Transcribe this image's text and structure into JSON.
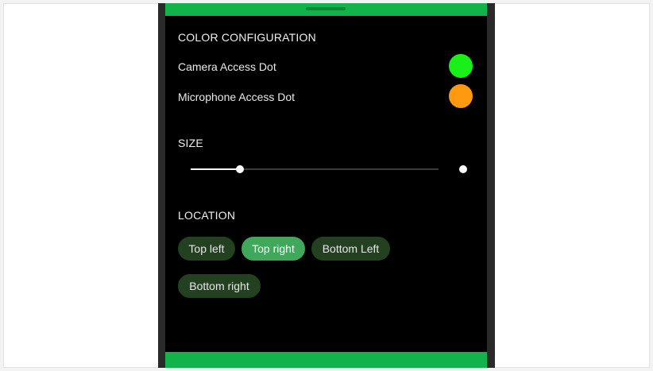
{
  "sections": {
    "color_title": "COLOR CONFIGURATION",
    "size_title": "SIZE",
    "location_title": "LOCATION"
  },
  "color_rows": [
    {
      "label": "Camera Access Dot",
      "color": "#18f018"
    },
    {
      "label": "Microphone Access Dot",
      "color": "#ff9a10"
    }
  ],
  "size_slider": {
    "value_fraction": 0.2
  },
  "location_chips": [
    {
      "label": "Top left",
      "selected": false
    },
    {
      "label": "Top right",
      "selected": true
    },
    {
      "label": "Bottom Left",
      "selected": false
    },
    {
      "label": "Bottom right",
      "selected": false
    }
  ],
  "colors": {
    "accent_bar": "#12b34a",
    "chip_bg": "#234021",
    "chip_selected_bg": "#3fa85b"
  }
}
